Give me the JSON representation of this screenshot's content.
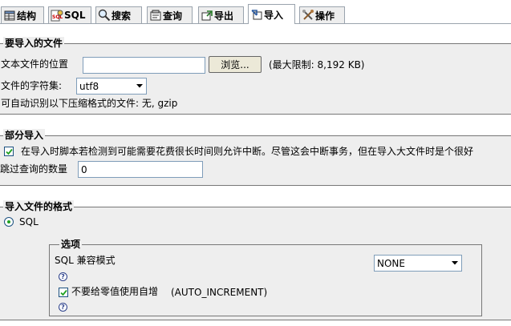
{
  "tabs": [
    {
      "label": "结构",
      "icon": "structure-icon"
    },
    {
      "label": "SQL",
      "icon": "sql-icon"
    },
    {
      "label": "搜索",
      "icon": "search-icon"
    },
    {
      "label": "查询",
      "icon": "query-icon"
    },
    {
      "label": "导出",
      "icon": "export-icon"
    },
    {
      "label": "导入",
      "icon": "import-icon",
      "active": true
    },
    {
      "label": "操作",
      "icon": "operations-icon"
    }
  ],
  "file_section": {
    "legend": "要导入的文件",
    "file_label": "文本文件的位置",
    "file_value": "",
    "browse_label": "浏览...",
    "max_size": "(最大限制: 8,192 KB)",
    "charset_label": "文件的字符集:",
    "charset_value": "utf8",
    "compression_note": "可自动识别以下压缩格式的文件: 无, gzip"
  },
  "partial_section": {
    "legend": "部分导入",
    "interrupt_label": "在导入时脚本若检测到可能需要花费很长时间则允许中断。尽管这会中断事务，但在导入大文件时是个很好",
    "interrupt_checked": true,
    "skip_label": "跳过查询的数量",
    "skip_value": "0"
  },
  "format_section": {
    "legend": "导入文件的格式",
    "format_option": "SQL",
    "format_selected": true,
    "options": {
      "legend": "选项",
      "compat_label": "SQL 兼容模式",
      "compat_value": "NONE",
      "help_glyph": "?",
      "auto_inc_label": "不要给零值使用自增",
      "auto_inc_suffix": "(AUTO_INCREMENT)",
      "auto_inc_checked": true
    }
  }
}
